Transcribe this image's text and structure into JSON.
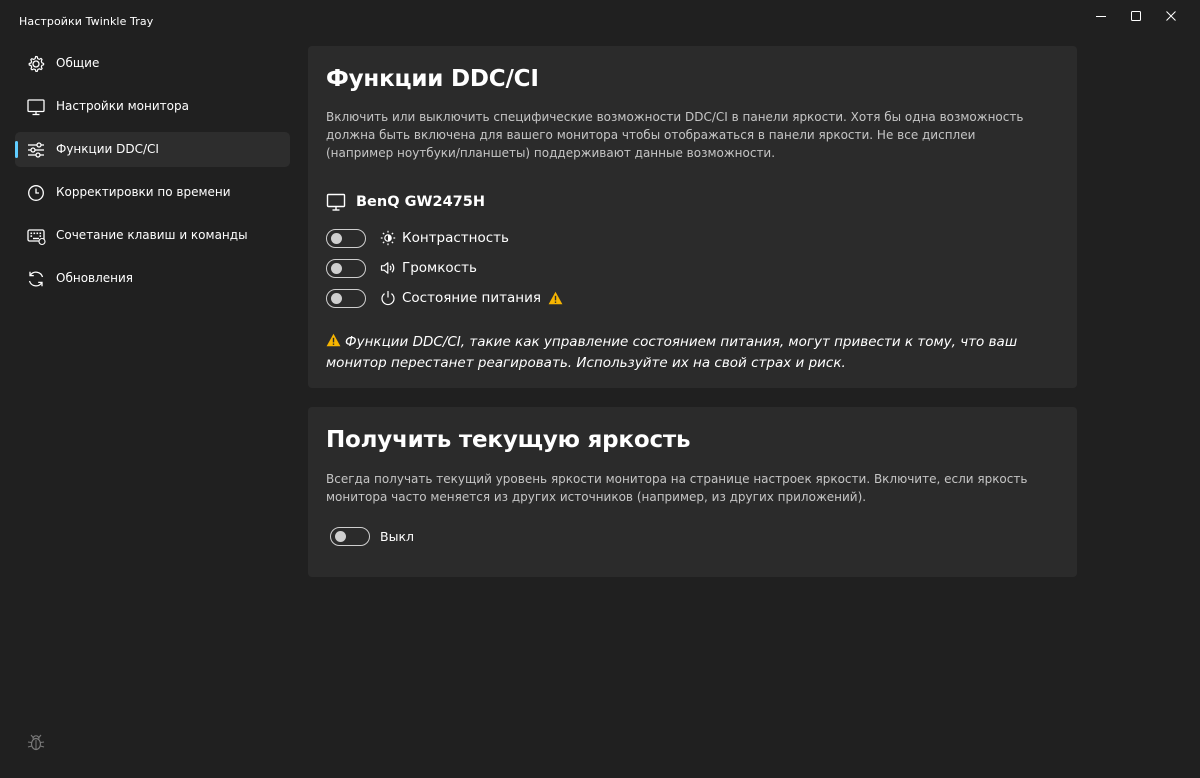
{
  "window": {
    "title": "Настройки Twinkle Tray"
  },
  "sidebar": {
    "items": [
      {
        "label": "Общие",
        "icon": "gear-icon"
      },
      {
        "label": "Настройки монитора",
        "icon": "monitor-icon"
      },
      {
        "label": "Функции DDC/CI",
        "icon": "sliders-icon",
        "active": true
      },
      {
        "label": "Корректировки по времени",
        "icon": "clock-icon"
      },
      {
        "label": "Сочетание клавиш и команды",
        "icon": "keyboard-icon"
      },
      {
        "label": "Обновления",
        "icon": "refresh-icon"
      }
    ],
    "footer_icon": "bug-icon"
  },
  "ddc": {
    "title": "Функции DDC/CI",
    "description": "Включить или выключить специфические возможности DDC/CI в панели яркости. Хотя бы одна возможность должна быть включена для вашего монитора чтобы отображаться в панели яркости. Не все дисплеи (например ноутбуки/планшеты) поддерживают данные возможности.",
    "monitor_name": "BenQ GW2475H",
    "features": [
      {
        "label": "Контрастность",
        "icon": "contrast-icon",
        "enabled": false
      },
      {
        "label": "Громкость",
        "icon": "volume-icon",
        "enabled": false
      },
      {
        "label": "Состояние питания",
        "icon": "power-icon",
        "enabled": false,
        "warning": true
      }
    ],
    "warning": "Функции DDC/CI, такие как управление состоянием питания, могут привести к тому, что ваш монитор перестанет реагировать. Используйте их на свой страх и риск."
  },
  "brightness": {
    "title": "Получить текущую яркость",
    "description": "Всегда получать текущий уровень яркости монитора на странице настроек яркости. Включите, если яркость монитора часто меняется из других источников (например, из других приложений).",
    "toggle_label": "Выкл",
    "enabled": false
  },
  "colors": {
    "background": "#202020",
    "panel": "#2b2b2b",
    "accent": "#60cdff",
    "warning": "#f7b500"
  }
}
